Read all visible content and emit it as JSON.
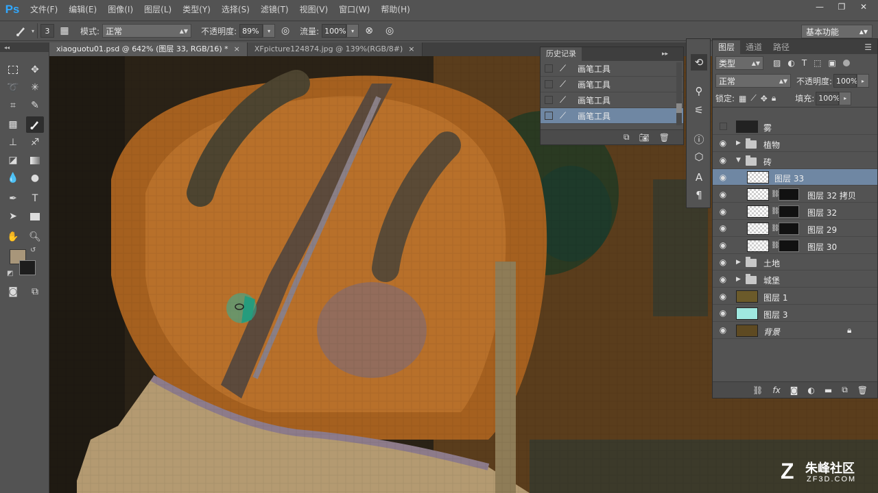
{
  "app": {
    "logo": "Ps"
  },
  "menu": [
    "文件(F)",
    "编辑(E)",
    "图像(I)",
    "图层(L)",
    "类型(Y)",
    "选择(S)",
    "滤镜(T)",
    "视图(V)",
    "窗口(W)",
    "帮助(H)"
  ],
  "window_controls": {
    "minimize": "—",
    "restore": "❐",
    "close": "✕"
  },
  "options": {
    "brush_size": "3",
    "mode_label": "模式:",
    "mode_value": "正常",
    "opacity_label": "不透明度:",
    "opacity_value": "89%",
    "flow_label": "流量:",
    "flow_value": "100%",
    "workspace": "基本功能"
  },
  "tabs": [
    {
      "label": "xiaoguotu01.psd @ 642% (图层 33, RGB/16) *",
      "close": "×"
    },
    {
      "label": "XFpicture124874.jpg @ 139%(RGB/8#)",
      "close": "×"
    }
  ],
  "history": {
    "title": "历史记录",
    "items": [
      "画笔工具",
      "画笔工具",
      "画笔工具",
      "画笔工具"
    ],
    "selected_index": 3
  },
  "layers_panel": {
    "tabs": [
      "图层",
      "通道",
      "路径"
    ],
    "filter_kind": "类型",
    "blend_mode": "正常",
    "opacity_label": "不透明度:",
    "opacity_value": "100%",
    "lock_label": "锁定:",
    "fill_label": "填充:",
    "fill_value": "100%",
    "layers": [
      {
        "name": "雾",
        "visible": false,
        "type": "layer"
      },
      {
        "name": "植物",
        "visible": true,
        "type": "group-collapsed"
      },
      {
        "name": "砖",
        "visible": true,
        "type": "group-open"
      },
      {
        "name": "图层 33",
        "visible": true,
        "type": "layer",
        "selected": true
      },
      {
        "name": "图层 32 拷贝",
        "visible": true,
        "type": "masked"
      },
      {
        "name": "图层 32",
        "visible": true,
        "type": "masked"
      },
      {
        "name": "图层 29",
        "visible": true,
        "type": "masked"
      },
      {
        "name": "图层 30",
        "visible": true,
        "type": "masked"
      },
      {
        "name": "土地",
        "visible": true,
        "type": "group-collapsed"
      },
      {
        "name": "城堡",
        "visible": true,
        "type": "group-collapsed"
      },
      {
        "name": "图层 1",
        "visible": true,
        "type": "layer"
      },
      {
        "name": "图层 3",
        "visible": true,
        "type": "layer"
      },
      {
        "name": "背景",
        "visible": true,
        "type": "background",
        "locked": true
      }
    ]
  },
  "watermark": {
    "logo": "Z",
    "cn": "朱峰社区",
    "en": "ZF3D.COM"
  },
  "colors": {
    "foreground": "#a8967a",
    "background": "#1d1d1d",
    "selection": "#6f87a3"
  }
}
